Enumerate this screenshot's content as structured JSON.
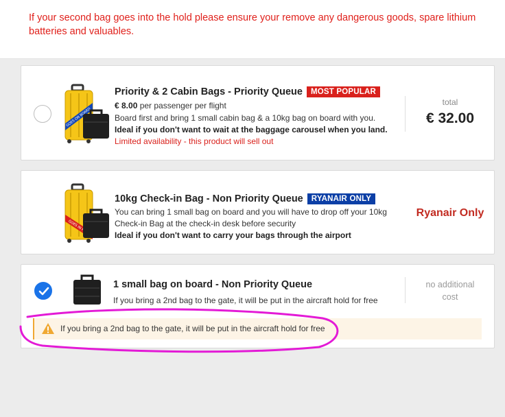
{
  "notice": {
    "text": "If your second bag goes into the hold please ensure your remove any dangerous goods, spare lithium batteries and valuables."
  },
  "options": [
    {
      "title": "Priority & 2 Cabin Bags - Priority Queue",
      "badge": "MOST POPULAR",
      "price_amount": "€ 8.00",
      "price_unit": " per passenger per flight",
      "desc": "Board first and bring 1 small cabin bag & a 10kg bag on board with you.",
      "desc_bold": "Ideal if you don't want to wait at the baggage carousel when you land.",
      "note": "Limited availability - this product will sell out",
      "total_label": "total",
      "total_value": "€ 32.00",
      "suitcase_tag": "GOES ON BOARD"
    },
    {
      "title": "10kg Check-in Bag - Non Priority Queue",
      "badge": "RYANAIR ONLY",
      "desc_line1": "You can bring 1 small bag on board and you will have to drop off your 10kg",
      "desc_line2": "Check-in Bag at the check-in desk before security",
      "desc_bold": "Ideal if you don't want to carry your bags through the airport",
      "status": "Ryanair Only",
      "suitcase_tag": "GOES IN HOLD"
    },
    {
      "title": "1 small bag on board - Non Priority Queue",
      "desc": "If you bring a 2nd bag to the gate, it will be put in the aircraft hold for free",
      "cost_line1": "no additional",
      "cost_line2": "cost",
      "selected": true
    }
  ],
  "warning": {
    "text": "If you bring a 2nd bag to the gate, it will be put in the aircraft hold for free"
  },
  "colors": {
    "alert_red": "#e0201b",
    "badge_red": "#d9211c",
    "badge_blue": "#0c3fa6",
    "selected_blue": "#1a73e8",
    "warning_orange": "#f0a832",
    "highlight_magenta": "#e31ad6"
  }
}
